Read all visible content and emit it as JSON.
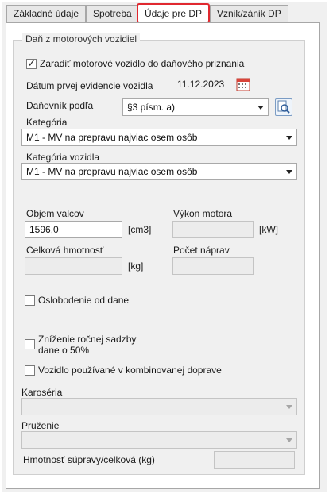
{
  "tabs": [
    {
      "label": "Základné údaje",
      "active": false
    },
    {
      "label": "Spotreba",
      "active": false
    },
    {
      "label": "Údaje pre DP",
      "active": true
    },
    {
      "label": "Vznik/zánik DP",
      "active": false
    }
  ],
  "group": {
    "title": "Daň z motorových vozidiel",
    "include_checkbox": {
      "label": "Zaradiť motorové vozidlo do daňového priznania",
      "checked": true
    },
    "first_registration": {
      "label": "Dátum prvej evidencie vozidla",
      "value": "11.12.2023"
    },
    "taxpayer": {
      "label": "Daňovník podľa",
      "value": "§3 písm. a)"
    },
    "category": {
      "label": "Kategória",
      "value": "M1 - MV na prepravu najviac osem osôb"
    },
    "vehicle_category": {
      "label": "Kategória vozidla",
      "value": "M1 - MV na prepravu najviac osem osôb"
    },
    "engine_volume": {
      "label": "Objem valcov",
      "value": "1596,0",
      "unit": "[cm3]"
    },
    "engine_power": {
      "label": "Výkon motora",
      "value": "",
      "unit": "[kW]"
    },
    "total_weight": {
      "label": "Celková hmotnosť",
      "value": "",
      "unit": "[kg]"
    },
    "axle_count": {
      "label": "Počet náprav",
      "value": ""
    },
    "tax_exemption": {
      "label": "Oslobodenie od dane",
      "checked": false
    },
    "rate_reduction": {
      "label_line1": "Zníženie ročnej sadzby",
      "label_line2": "dane o 50%",
      "checked": false
    },
    "combined_transport": {
      "label": "Vozidlo používané v kombinovanej doprave",
      "checked": false
    },
    "body": {
      "label": "Karoséria",
      "value": ""
    },
    "suspension": {
      "label": "Pruženie",
      "value": ""
    },
    "combo_weight": {
      "label": "Hmotnosť súpravy/celková (kg)",
      "value": ""
    }
  },
  "colors": {
    "active_tab_border": "#e0282f",
    "panel_bg": "#f0f0f0"
  }
}
